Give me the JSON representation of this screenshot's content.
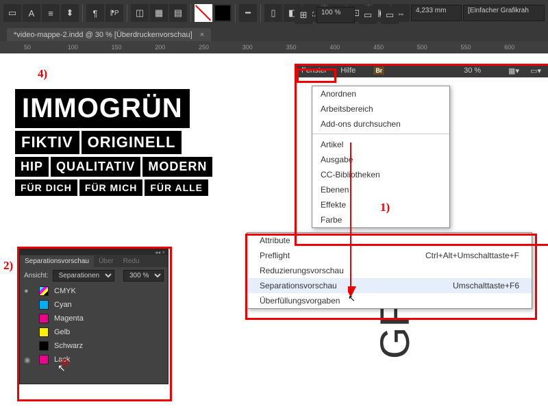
{
  "toolbar": {
    "measure": "4,233 mm",
    "zoom_dropdown": "100 %",
    "frame_label": "[Einfacher Grafikrah"
  },
  "document": {
    "tab": "*video-mappe-2.indd @ 30 % [Überdruckenvorschau]"
  },
  "ruler": [
    "50",
    "100",
    "150",
    "200",
    "250",
    "300",
    "350",
    "400",
    "450",
    "500",
    "550",
    "600"
  ],
  "logo": {
    "line1": "IMMOGRÜN",
    "line2": [
      "FIKTIV",
      "ORIGINELL"
    ],
    "line3": [
      "HIP",
      "QUALITATIV",
      "MODERN"
    ],
    "line4": [
      "FÜR DICH",
      "FÜR MICH",
      "FÜR ALLE"
    ]
  },
  "annotations": {
    "a1": "4)",
    "a2": "2)",
    "a3": "3)",
    "a4": "1)"
  },
  "menubar": {
    "fenster": "Fenster",
    "hilfe": "Hilfe",
    "br": "Br",
    "zoom": "30 %"
  },
  "menu": {
    "items": [
      "Anordnen",
      "Arbeitsbereich",
      "Add-ons durchsuchen"
    ],
    "items2": [
      "Artikel",
      "Ausgabe",
      "CC-Bibliotheken",
      "Ebenen",
      "Effekte",
      "Farbe"
    ]
  },
  "submenu": {
    "items": [
      {
        "label": "Attribute",
        "shortcut": ""
      },
      {
        "label": "Preflight",
        "shortcut": "Ctrl+Alt+Umschalttaste+F"
      },
      {
        "label": "Reduzierungsvorschau",
        "shortcut": ""
      },
      {
        "label": "Separationsvorschau",
        "shortcut": "Umschalttaste+F6"
      },
      {
        "label": "Überfüllungsvorgaben",
        "shortcut": ""
      }
    ]
  },
  "panel": {
    "title": "Separationsvorschau",
    "tabs": [
      "Über",
      "Redu"
    ],
    "view_label": "Ansicht:",
    "view_value": "Separationen",
    "zoom": "300 %",
    "inks": [
      {
        "name": "CMYK",
        "color": "linear-gradient(135deg,#0ff 0 25%,#f0f 25% 50%,#ff0 50% 75%,#000 75%)",
        "eye": "●"
      },
      {
        "name": "Cyan",
        "color": "#00aeef"
      },
      {
        "name": "Magenta",
        "color": "#ec008c"
      },
      {
        "name": "Gelb",
        "color": "#fff200"
      },
      {
        "name": "Schwarz",
        "color": "#000"
      },
      {
        "name": "Lack",
        "color": "#ec008c",
        "eye": "◉"
      }
    ]
  },
  "big_text": "GF"
}
